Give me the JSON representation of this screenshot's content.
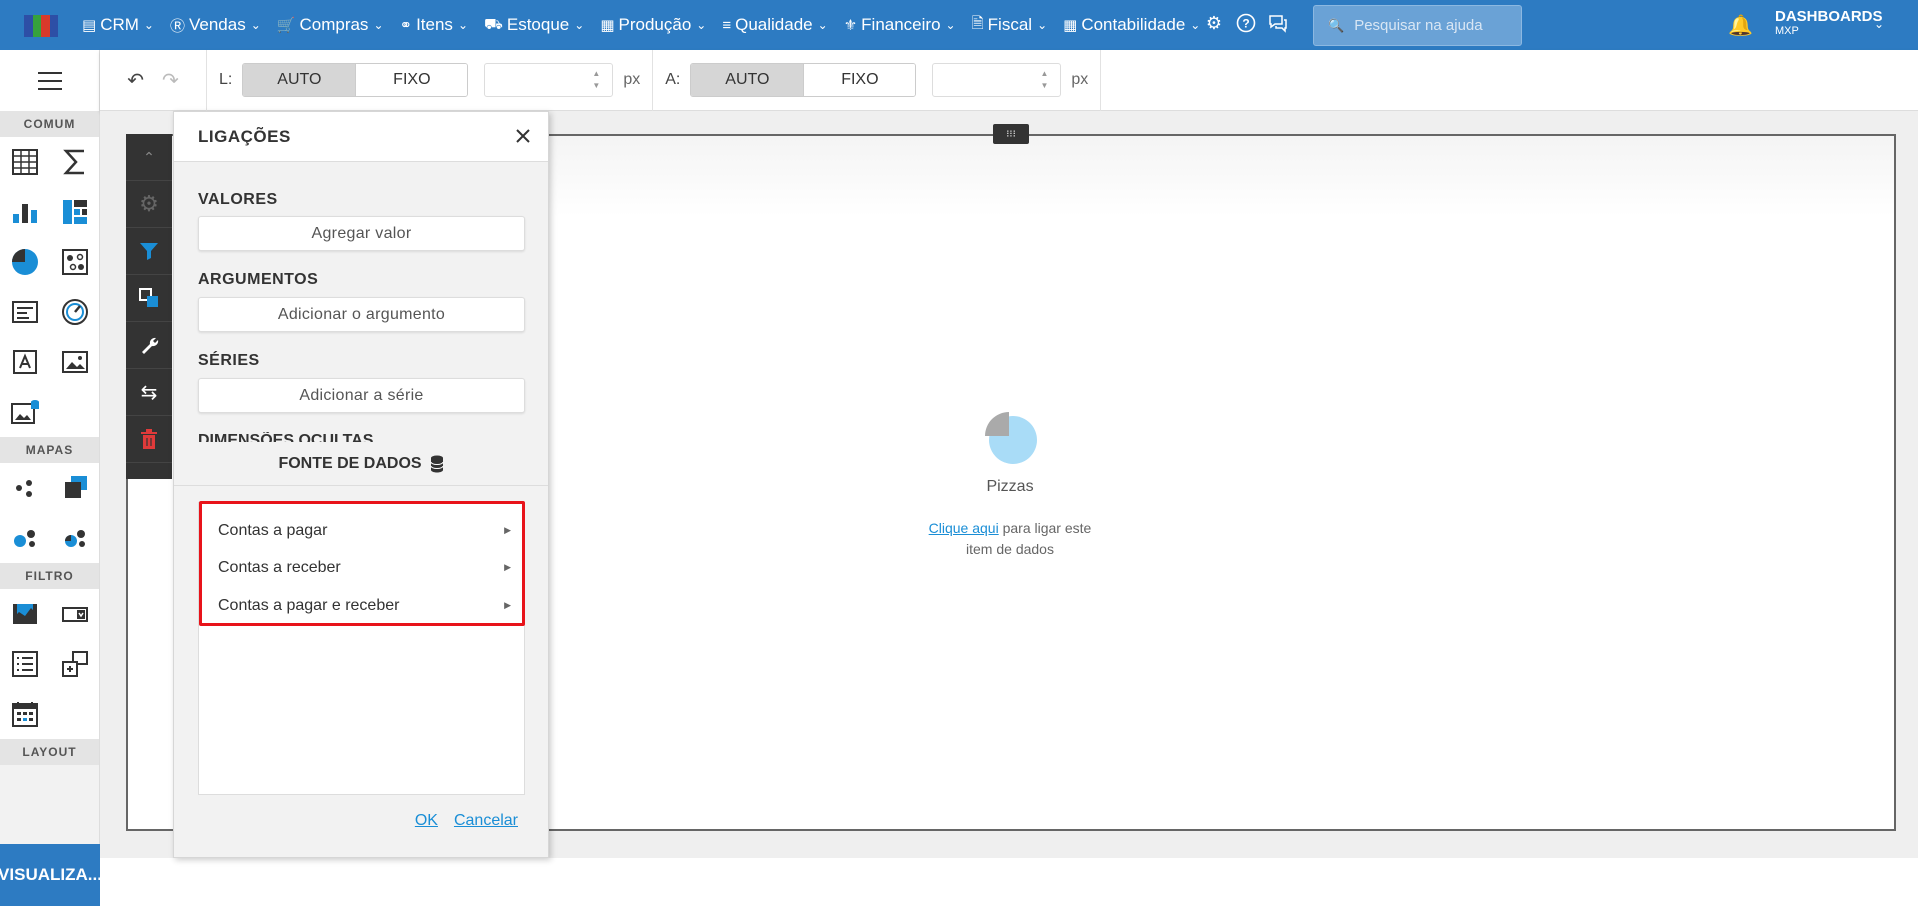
{
  "topbar": {
    "menu": [
      {
        "label": "CRM",
        "icon": "crm-icon"
      },
      {
        "label": "Vendas",
        "icon": "dollar-icon"
      },
      {
        "label": "Compras",
        "icon": "cart-icon"
      },
      {
        "label": "Itens",
        "icon": "items-icon"
      },
      {
        "label": "Estoque",
        "icon": "truck-icon"
      },
      {
        "label": "Produção",
        "icon": "factory-icon"
      },
      {
        "label": "Qualidade",
        "icon": "quality-icon"
      },
      {
        "label": "Financeiro",
        "icon": "money-bag-icon"
      },
      {
        "label": "Fiscal",
        "icon": "document-icon"
      },
      {
        "label": "Contabilidade",
        "icon": "ledger-icon"
      }
    ],
    "search_placeholder": "Pesquisar na ajuda",
    "dashboards_label": "DASHBOARDS",
    "dashboards_sub": "MXP"
  },
  "sidebar": {
    "sections": {
      "comum": "COMUM",
      "mapas": "MAPAS",
      "filtro": "FILTRO",
      "layout": "LAYOUT"
    },
    "visualize_label": "VISUALIZA..."
  },
  "toolbar": {
    "width_label": "L:",
    "height_label": "A:",
    "auto": "AUTO",
    "fixo": "FIXO",
    "unit": "px"
  },
  "panel": {
    "title": "LIGAÇÕES",
    "valores": "VALORES",
    "add_value": "Agregar valor",
    "argumentos": "ARGUMENTOS",
    "add_argument": "Adicionar o argumento",
    "series": "SÉRIES",
    "add_series": "Adicionar a série",
    "hidden_dims": "DIMENSÕES OCULTAS",
    "datasource_title": "FONTE DE DADOS",
    "datasources": [
      "Contas a pagar",
      "Contas a receber",
      "Contas a pagar e receber"
    ],
    "ok": "OK",
    "cancel": "Cancelar"
  },
  "canvas": {
    "item_title": "Pizzas",
    "hint_link": "Clique aqui",
    "hint_rest1": " para ligar este",
    "hint_rest2": "item de dados"
  },
  "colors": {
    "brand": "#2d7bc2",
    "highlight": "#e8131a",
    "link": "#1a8ed6",
    "filter_icon": "#1a8ed6",
    "delete_icon": "#e03a3a"
  }
}
